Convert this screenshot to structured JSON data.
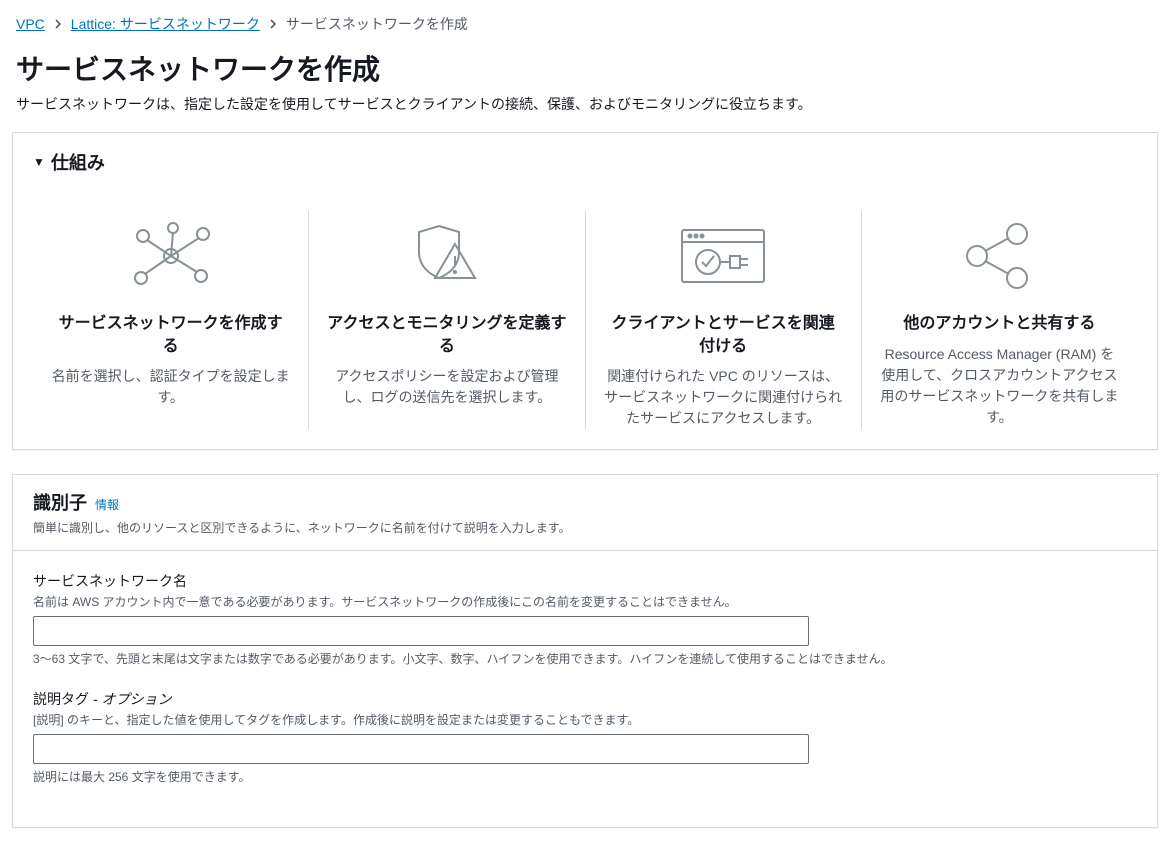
{
  "breadcrumb": {
    "items": [
      {
        "label": "VPC"
      },
      {
        "label": "Lattice: サービスネットワーク"
      }
    ],
    "current": "サービスネットワークを作成"
  },
  "header": {
    "title": "サービスネットワークを作成",
    "description": "サービスネットワークは、指定した設定を使用してサービスとクライアントの接続、保護、およびモニタリングに役立ちます。"
  },
  "howItWorks": {
    "title": "仕組み",
    "cards": [
      {
        "title": "サービスネットワークを作成する",
        "description": "名前を選択し、認証タイプを設定します。"
      },
      {
        "title": "アクセスとモニタリングを定義する",
        "description": "アクセスポリシーを設定および管理し、ログの送信先を選択します。"
      },
      {
        "title": "クライアントとサービスを関連付ける",
        "description": "関連付けられた VPC のリソースは、サービスネットワークに関連付けられたサービスにアクセスします。"
      },
      {
        "title": "他のアカウントと共有する",
        "description": "Resource Access Manager (RAM) を使用して、クロスアカウントアクセス用のサービスネットワークを共有します。"
      }
    ]
  },
  "identifiers": {
    "title": "識別子",
    "infoLabel": "情報",
    "description": "簡単に識別し、他のリソースと区別できるように、ネットワークに名前を付けて説明を入力します。",
    "fields": {
      "name": {
        "label": "サービスネットワーク名",
        "constraint": "名前は AWS アカウント内で一意である必要があります。サービスネットワークの作成後にこの名前を変更することはできません。",
        "value": "",
        "hint": "3～63 文字で、先頭と末尾は文字または数字である必要があります。小文字、数字、ハイフンを使用できます。ハイフンを連続して使用することはできません。"
      },
      "descriptionTag": {
        "label_prefix": "説明タグ ",
        "label_suffix": "- オプション",
        "constraint": "[説明] のキーと、指定した値を使用してタグを作成します。作成後に説明を設定または変更することもできます。",
        "value": "",
        "hint": "説明には最大 256 文字を使用できます。"
      }
    }
  }
}
